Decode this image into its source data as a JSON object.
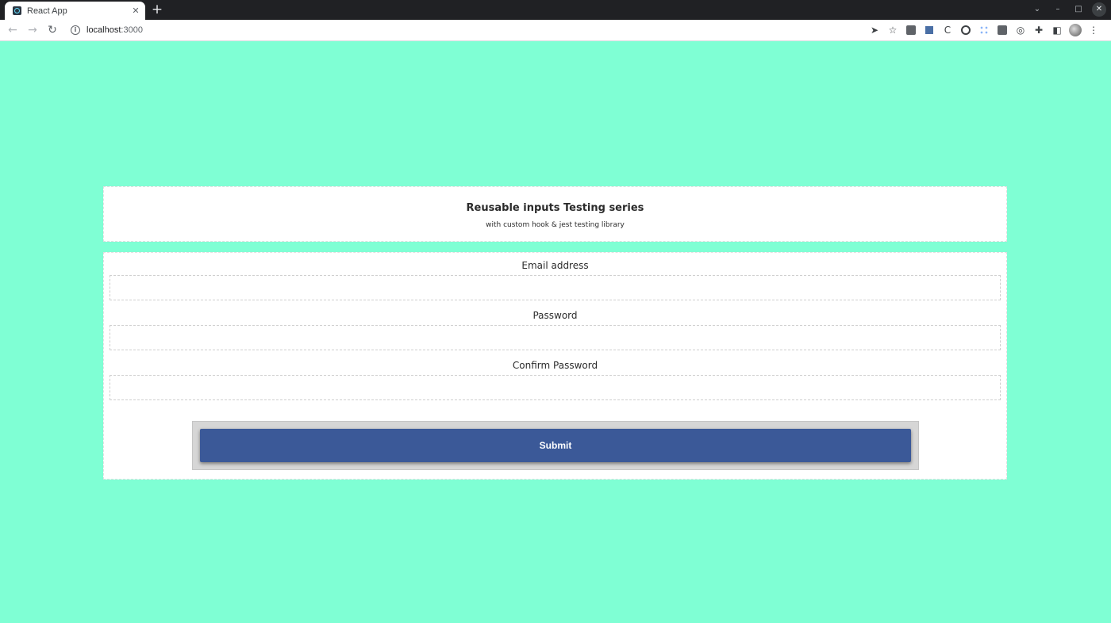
{
  "browser": {
    "tab_title": "React App",
    "tab_close": "✕",
    "new_tab": "+",
    "url_host": "localhost",
    "url_port": ":3000",
    "window_controls": {
      "dropdown": "⌄",
      "minimize": "–",
      "maximize": "□",
      "close": "✕"
    }
  },
  "header": {
    "title": "Reusable inputs Testing series",
    "subtitle": "with custom hook & jest testing library"
  },
  "form": {
    "email_label": "Email address",
    "email_value": "",
    "password_label": "Password",
    "password_value": "",
    "confirm_label": "Confirm Password",
    "confirm_value": "",
    "submit_label": "Submit"
  },
  "colors": {
    "page_background": "#7fffd4",
    "submit_button": "#3b5998",
    "submit_wrap": "#d6d6d6"
  }
}
